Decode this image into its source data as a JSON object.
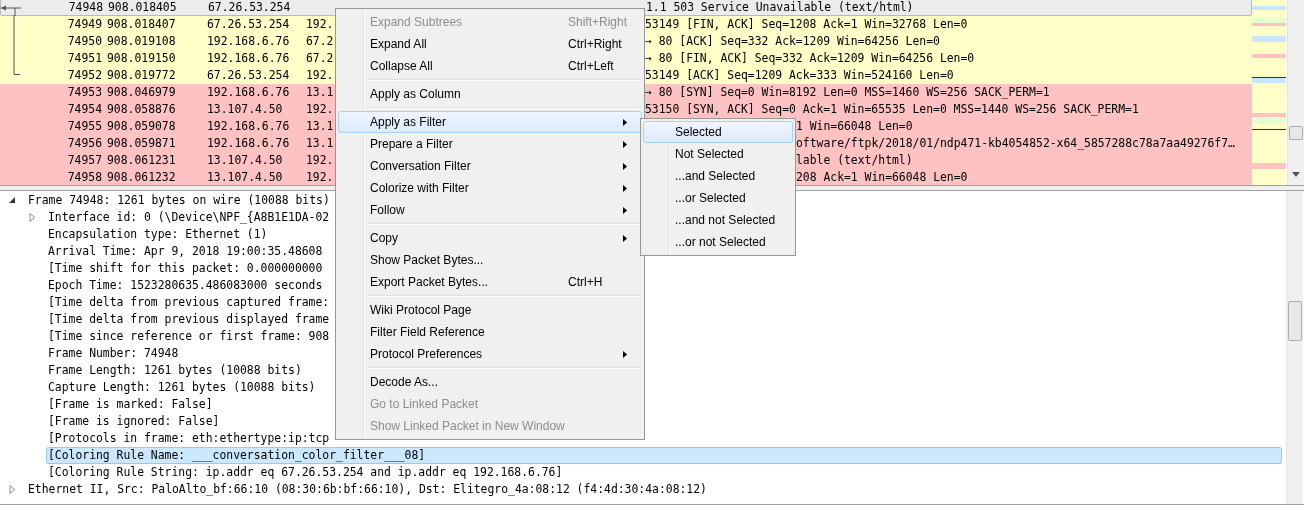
{
  "packet_list": {
    "rows": [
      {
        "number": "74948",
        "time": "908.018405",
        "source": "67.26.53.254",
        "info": "1.1 503 Service Unavailable  (text/html)",
        "under_submenu": false,
        "color": "#ececec",
        "selected": true,
        "related": true
      },
      {
        "number": "74949",
        "time": "908.018407",
        "source": "67.26.53.254",
        "destination": "192.",
        "info": "53149 [FIN, ACK] Seq=1208 Ack=1 Win=32768 Len=0",
        "under_submenu": false,
        "color": "#ffffc8",
        "selected": false,
        "related": true
      },
      {
        "number": "74950",
        "time": "908.019108",
        "source": "192.168.6.76",
        "destination": "67.2",
        "info": "→ 80 [ACK] Seq=332 Ack=1209 Win=64256 Len=0",
        "under_submenu": false,
        "color": "#ffffc8",
        "selected": false,
        "related": true
      },
      {
        "number": "74951",
        "time": "908.019150",
        "source": "192.168.6.76",
        "destination": "67.2",
        "info": "→ 80 [FIN, ACK] Seq=332 Ack=1209 Win=64256 Len=0",
        "under_submenu": false,
        "color": "#ffffc8",
        "selected": false,
        "related": true
      },
      {
        "number": "74952",
        "time": "908.019772",
        "source": "67.26.53.254",
        "destination": "192.",
        "info": "53149 [ACK] Seq=1209 Ack=333 Win=524160 Len=0",
        "under_submenu": false,
        "color": "#ffffc8",
        "selected": false,
        "related": true
      },
      {
        "number": "74953",
        "time": "908.046979",
        "source": "192.168.6.76",
        "destination": "13.1",
        "info": "→ 80 [SYN] Seq=0 Win=8192 Len=0 MSS=1460 WS=256 SACK_PERM=1",
        "under_submenu": false,
        "color": "#ffc2c2",
        "selected": false,
        "related": false
      },
      {
        "number": "74954",
        "time": "908.058876",
        "source": "13.107.4.50",
        "destination": "192.",
        "info": "53150 [SYN, ACK] Seq=0 Ack=1 Win=65535 Len=0 MSS=1440 WS=256 SACK_PERM=1",
        "under_submenu": false,
        "color": "#ffc2c2",
        "selected": false,
        "related": false
      },
      {
        "number": "74955",
        "time": "908.059078",
        "source": "192.168.6.76",
        "destination": "13.1",
        "info": "1 Win=66048 Len=0",
        "under_submenu": true,
        "color": "#ffc2c2",
        "selected": false,
        "related": false
      },
      {
        "number": "74956",
        "time": "908.059871",
        "source": "192.168.6.76",
        "destination": "13.1",
        "info": "oftware/ftpk/2018/01/ndp471-kb4054852-x64_5857288c78a7aa49276f7…",
        "under_submenu": true,
        "color": "#ffc2c2",
        "selected": false,
        "related": false
      },
      {
        "number": "74957",
        "time": "908.061231",
        "source": "13.107.4.50",
        "destination": "192.",
        "info": "lable  (text/html)",
        "under_submenu": true,
        "color": "#ffc2c2",
        "selected": false,
        "related": false
      },
      {
        "number": "74958",
        "time": "908.061232",
        "source": "13.107.4.50",
        "destination": "192.",
        "info": "208 Ack=1 Win=66048 Len=0",
        "under_submenu": true,
        "color": "#ffc2c2",
        "selected": false,
        "related": false
      }
    ]
  },
  "details": [
    {
      "text": "Frame 74948: 1261 bytes on wire (10088 bits)",
      "expanded": true,
      "selected": false,
      "children": [
        {
          "text": "Interface id: 0 (\\Device\\NPF_{A8B1E1DA-02",
          "expanded": false,
          "selected": false
        },
        {
          "text": "Encapsulation type: Ethernet (1)",
          "selected": false
        },
        {
          "text": "Arrival Time: Apr  9, 2018 19:00:35.48608",
          "selected": false
        },
        {
          "text": "[Time shift for this packet: 0.000000000",
          "selected": false
        },
        {
          "text": "Epoch Time: 1523280635.486083000 seconds",
          "selected": false
        },
        {
          "text": "[Time delta from previous captured frame:",
          "selected": false
        },
        {
          "text": "[Time delta from previous displayed frame",
          "selected": false
        },
        {
          "text": "[Time since reference or first frame: 908",
          "selected": false
        },
        {
          "text": "Frame Number: 74948",
          "selected": false
        },
        {
          "text": "Frame Length: 1261 bytes (10088 bits)",
          "selected": false
        },
        {
          "text": "Capture Length: 1261 bytes (10088 bits)",
          "selected": false
        },
        {
          "text": "[Frame is marked: False]",
          "selected": false
        },
        {
          "text": "[Frame is ignored: False]",
          "selected": false
        },
        {
          "text": "[Protocols in frame: eth:ethertype:ip:tcp",
          "selected": false
        },
        {
          "text": "[Coloring Rule Name: ___conversation_color_filter___08]",
          "selected": true
        },
        {
          "text": "[Coloring Rule String: ip.addr eq 67.26.53.254 and ip.addr eq 192.168.6.76]",
          "selected": false
        }
      ]
    },
    {
      "text": "Ethernet II, Src: PaloAlto_bf:66:10 (08:30:6b:bf:66:10), Dst: Elitegro_4a:08:12 (f4:4d:30:4a:08:12)",
      "expanded": false,
      "selected": false
    }
  ],
  "context_menu": {
    "items": [
      {
        "kind": "item",
        "label": "Expand Subtrees",
        "shortcut": "Shift+Right",
        "disabled": true,
        "submenu": false,
        "selected": false
      },
      {
        "kind": "item",
        "label": "Expand All",
        "shortcut": "Ctrl+Right",
        "disabled": false,
        "submenu": false,
        "selected": false
      },
      {
        "kind": "item",
        "label": "Collapse All",
        "shortcut": "Ctrl+Left",
        "disabled": false,
        "submenu": false,
        "selected": false
      },
      {
        "kind": "separator"
      },
      {
        "kind": "item",
        "label": "Apply as Column",
        "disabled": false,
        "submenu": false,
        "selected": false
      },
      {
        "kind": "separator"
      },
      {
        "kind": "item",
        "label": "Apply as Filter",
        "disabled": false,
        "submenu": true,
        "selected": true
      },
      {
        "kind": "item",
        "label": "Prepare a Filter",
        "disabled": false,
        "submenu": true,
        "selected": false
      },
      {
        "kind": "item",
        "label": "Conversation Filter",
        "disabled": false,
        "submenu": true,
        "selected": false
      },
      {
        "kind": "item",
        "label": "Colorize with Filter",
        "disabled": false,
        "submenu": true,
        "selected": false
      },
      {
        "kind": "item",
        "label": "Follow",
        "disabled": false,
        "submenu": true,
        "selected": false
      },
      {
        "kind": "separator"
      },
      {
        "kind": "item",
        "label": "Copy",
        "disabled": false,
        "submenu": true,
        "selected": false
      },
      {
        "kind": "item",
        "label": "Show Packet Bytes...",
        "disabled": false,
        "submenu": false,
        "selected": false
      },
      {
        "kind": "item",
        "label": "Export Packet Bytes...",
        "shortcut": "Ctrl+H",
        "disabled": false,
        "submenu": false,
        "selected": false
      },
      {
        "kind": "separator"
      },
      {
        "kind": "item",
        "label": "Wiki Protocol Page",
        "disabled": false,
        "submenu": false,
        "selected": false
      },
      {
        "kind": "item",
        "label": "Filter Field Reference",
        "disabled": false,
        "submenu": false,
        "selected": false
      },
      {
        "kind": "item",
        "label": "Protocol Preferences",
        "disabled": false,
        "submenu": true,
        "selected": false
      },
      {
        "kind": "separator"
      },
      {
        "kind": "item",
        "label": "Decode As...",
        "disabled": false,
        "submenu": false,
        "selected": false
      },
      {
        "kind": "item",
        "label": "Go to Linked Packet",
        "disabled": true,
        "submenu": false,
        "selected": false
      },
      {
        "kind": "item",
        "label": "Show Linked Packet in New Window",
        "disabled": true,
        "submenu": false,
        "selected": false
      }
    ]
  },
  "submenu": {
    "items": [
      {
        "label": "Selected",
        "selected": true
      },
      {
        "label": "Not Selected",
        "selected": false
      },
      {
        "label": "...and Selected",
        "selected": false
      },
      {
        "label": "...or Selected",
        "selected": false
      },
      {
        "label": "...and not Selected",
        "selected": false
      },
      {
        "label": "...or not Selected",
        "selected": false
      }
    ]
  }
}
